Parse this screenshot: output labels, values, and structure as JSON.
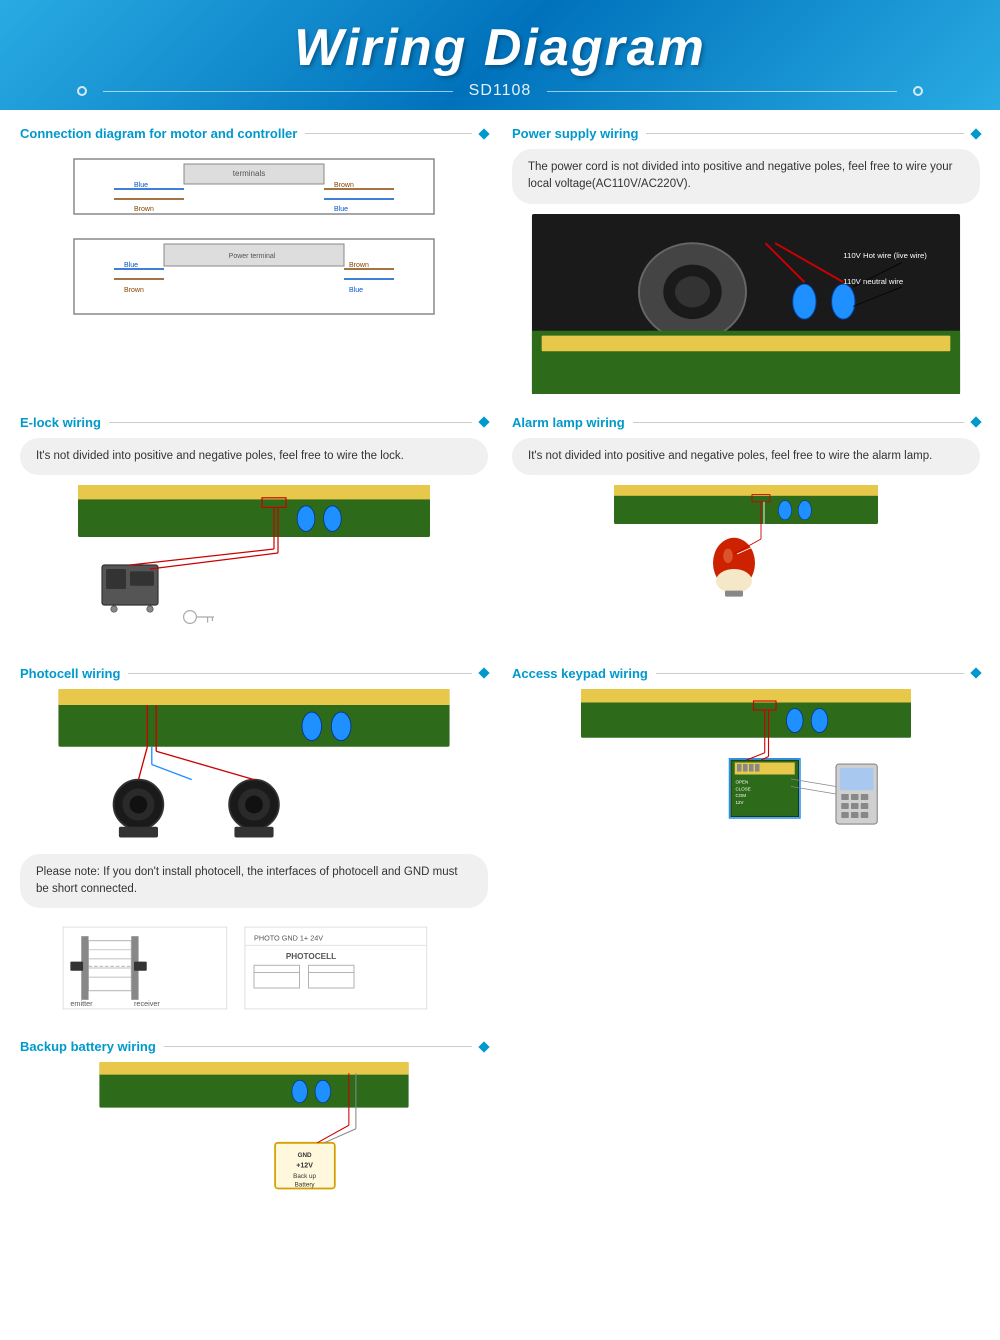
{
  "header": {
    "title": "Wiring Diagram",
    "subtitle": "SD1108"
  },
  "sections": {
    "motor": {
      "title": "Connection diagram for motor and controller"
    },
    "elock": {
      "title": "E-lock wiring",
      "note": "It's not divided into positive and negative poles, feel free to wire the lock."
    },
    "photocell": {
      "title": "Photocell wiring",
      "note": "Please note: If you don't install photocell, the interfaces of photocell and GND must be short connected."
    },
    "power": {
      "title": "Power supply wiring",
      "note": "The power cord is not divided into positive and negative poles, feel free to wire your local voltage(AC110V/AC220V)."
    },
    "alarm": {
      "title": "Alarm lamp wiring",
      "note": "It's not divided into positive and negative poles, feel free to wire the alarm lamp."
    },
    "keypad": {
      "title": "Access keypad wiring"
    },
    "battery": {
      "title": "Backup battery wiring"
    }
  },
  "power_labels": {
    "hot": "110V Hot wire (live wire)",
    "neutral": "110V neutral wire"
  },
  "battery_labels": {
    "gnd": "GND",
    "v12": "+12V",
    "backup": "Back up Battery"
  },
  "colors": {
    "accent": "#0099cc",
    "pcb_green": "#2d6b1a",
    "header_blue": "#0072bc",
    "terminal_yellow": "#e8c84a",
    "red_wire": "#cc0000",
    "blue_wire": "#1e90ff",
    "battery_border": "#d4a000"
  }
}
